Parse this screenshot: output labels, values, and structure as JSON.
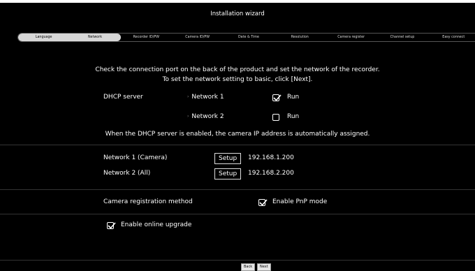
{
  "window": {
    "title": "Installation wizard"
  },
  "tabs": [
    {
      "label": "Language",
      "state": "done"
    },
    {
      "label": "Network",
      "state": "current"
    },
    {
      "label": "Recorder ID/PW",
      "state": "todo"
    },
    {
      "label": "Camera ID/PW",
      "state": "todo"
    },
    {
      "label": "Date & Time",
      "state": "todo"
    },
    {
      "label": "Resolution",
      "state": "todo"
    },
    {
      "label": "Camera register",
      "state": "todo"
    },
    {
      "label": "Channel setup",
      "state": "todo"
    },
    {
      "label": "Easy connect",
      "state": "todo"
    }
  ],
  "intro": {
    "line1": "Check the connection port on the back of the product and set the network of the recorder.",
    "line2": "To set the network setting to basic, click [Next]."
  },
  "dhcp": {
    "label": "DHCP server",
    "network1": {
      "label": "Network 1",
      "run_label": "Run",
      "checked": true
    },
    "network2": {
      "label": "Network 2",
      "run_label": "Run",
      "checked": false
    },
    "note": "When the DHCP server is enabled, the camera IP address is automatically assigned."
  },
  "networks": [
    {
      "label": "Network 1 (Camera)",
      "button": "Setup",
      "ip": "192.168.1.200"
    },
    {
      "label": "Network 2 (All)",
      "button": "Setup",
      "ip": "192.168.2.200"
    }
  ],
  "camera_registration": {
    "label": "Camera registration method",
    "option_label": "Enable PnP mode",
    "checked": true
  },
  "online_upgrade": {
    "label": "Enable online upgrade",
    "checked": true
  },
  "footer": {
    "back_label": "Back",
    "next_label": "Next"
  }
}
